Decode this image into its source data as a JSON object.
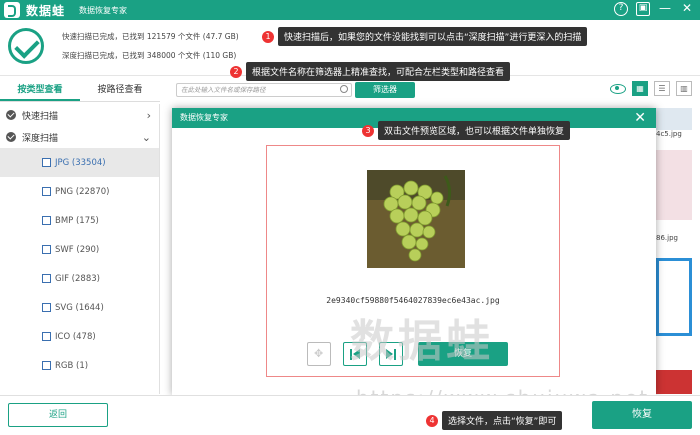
{
  "titlebar": {
    "brand": "数据蛙",
    "app_name": "数据恢复专家",
    "help_glyph": "?",
    "save_glyph": "▣",
    "minimize_glyph": "—",
    "close_glyph": "✕"
  },
  "status": {
    "quick_scan": "快速扫描已完成，已找到 121579 个文件 (47.7 GB)",
    "deep_scan": "深度扫描已完成，已找到 348000 个文件 (110 GB)"
  },
  "callouts": [
    {
      "num": "1",
      "text": "快速扫描后，如果您的文件没能找到可以点击“深度扫描”进行更深入的扫描"
    },
    {
      "num": "2",
      "text": "根据文件名称在筛选器上精准查找，可配合左栏类型和路径查看"
    },
    {
      "num": "3",
      "text": "双击文件预览区域，也可以根据文件单独恢复"
    },
    {
      "num": "4",
      "text": "选择文件，点击“恢复”即可"
    }
  ],
  "left_tabs": [
    "按类型查看",
    "按路径查看"
  ],
  "tree": {
    "quick_scan_label": "快速扫描",
    "deep_scan_label": "深度扫描",
    "expand_glyph": "›",
    "collapse_glyph": "⌄",
    "types": [
      "JPG (33504)",
      "PNG (22870)",
      "BMP (175)",
      "SWF (290)",
      "GIF (2883)",
      "SVG (1644)",
      "ICO (478)",
      "RGB (1)"
    ]
  },
  "toolbar": {
    "search_placeholder": "在此处输入文件名或保存路径",
    "filter_label": "筛选器",
    "view_grid": "▦",
    "view_list": "☰",
    "view_detail": "▥"
  },
  "thumb_captions": [
    ".jpg",
    "4c5.jpg",
    "86.jpg"
  ],
  "dialog": {
    "title": "数据恢复专家",
    "close_glyph": "✕",
    "filename": "2e9340cf59880f5464027839ec6e43ac.jpg",
    "recover_label": "恢复"
  },
  "footer": {
    "back_label": "返回",
    "recover_label": "恢复"
  },
  "watermark": {
    "cn": "数据蛙",
    "url": "https://www.shujuwa.net"
  },
  "colors": {
    "brand": "#1aa184",
    "callout_badge": "#e33333",
    "tooltip_bg": "#333333"
  }
}
